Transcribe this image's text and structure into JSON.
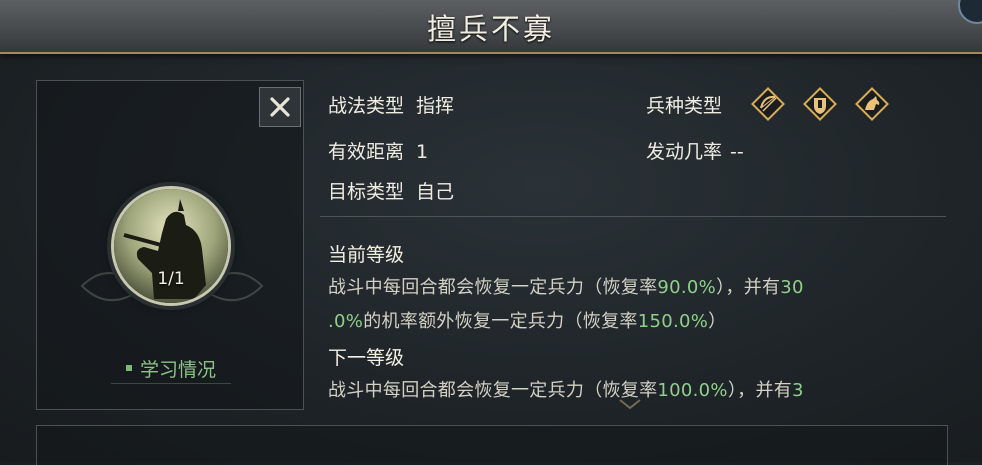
{
  "header": {
    "title": "擅兵不寡"
  },
  "skill": {
    "level_count": "1/1",
    "learn_status_label": "学习情况",
    "tactic_type_label": "战法类型",
    "tactic_type_value": "指挥",
    "range_label": "有效距离",
    "range_value": "1",
    "target_label": "目标类型",
    "target_value": "自己",
    "troop_type_label": "兵种类型",
    "troop_icons": [
      "bow-icon",
      "shield-icon",
      "cavalry-icon"
    ],
    "trigger_rate_label": "发动几率",
    "trigger_rate_value": "--"
  },
  "current_level": {
    "heading": "当前等级",
    "line1_a": "战斗中每回合都会恢复一定兵力（恢复率",
    "line1_b": "90.0%",
    "line1_c": "），并有",
    "line1_d": "30",
    "line2_a": ".0%",
    "line2_b": "的机率额外恢复一定兵力（恢复率",
    "line2_c": "150.0%",
    "line2_d": "）"
  },
  "next_level": {
    "heading": "下一等级",
    "line1_a": "战斗中每回合都会恢复一定兵力（恢复率",
    "line1_b": "100.0%",
    "line1_c": "），并有",
    "line1_d": "3"
  },
  "colors": {
    "accent_gold": "#d9ab55",
    "highlight_green": "#8fd08a",
    "title_border": "#a58a55"
  }
}
